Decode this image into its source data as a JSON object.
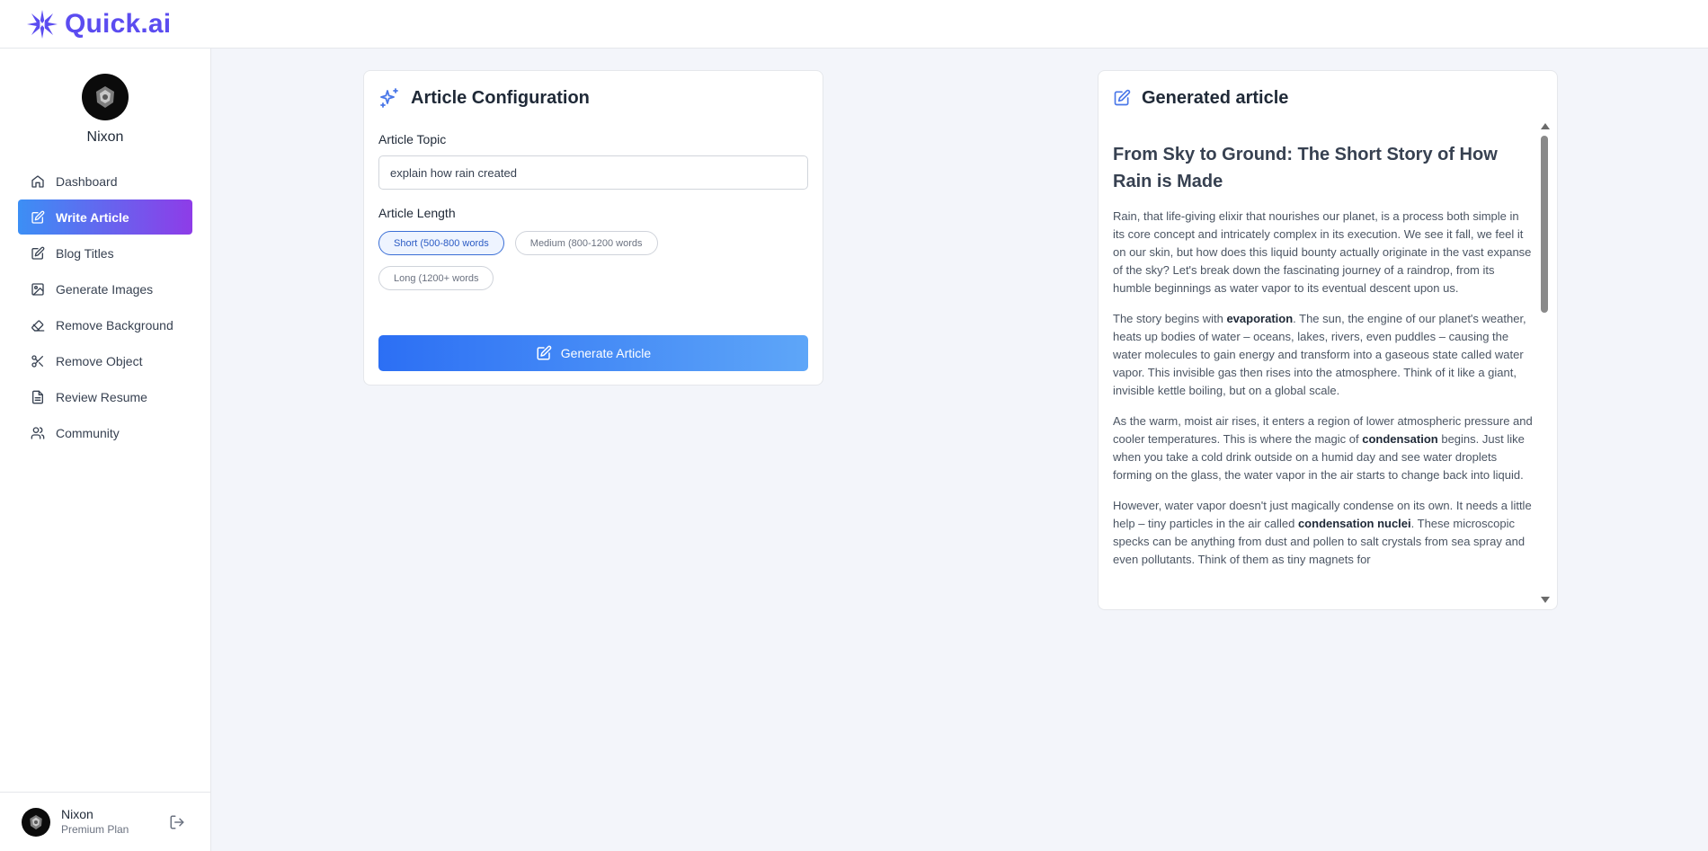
{
  "app": {
    "name": "Quick.ai",
    "brand_color": "#5b4cf0"
  },
  "user": {
    "name": "Nixon",
    "plan": "Premium Plan"
  },
  "sidebar": {
    "items": [
      {
        "label": "Dashboard",
        "icon": "home-icon",
        "active": false
      },
      {
        "label": "Write Article",
        "icon": "edit-icon",
        "active": true
      },
      {
        "label": "Blog Titles",
        "icon": "edit-icon",
        "active": false
      },
      {
        "label": "Generate Images",
        "icon": "image-icon",
        "active": false
      },
      {
        "label": "Remove Background",
        "icon": "eraser-icon",
        "active": false
      },
      {
        "label": "Remove Object",
        "icon": "scissors-icon",
        "active": false
      },
      {
        "label": "Review Resume",
        "icon": "file-text-icon",
        "active": false
      },
      {
        "label": "Community",
        "icon": "users-icon",
        "active": false
      }
    ]
  },
  "config": {
    "title": "Article Configuration",
    "topic_label": "Article Topic",
    "topic_value": "explain how rain created",
    "length_label": "Article Length",
    "length_options": [
      {
        "label": "Short (500-800 words",
        "selected": true
      },
      {
        "label": "Medium (800-1200 words",
        "selected": false
      },
      {
        "label": "Long (1200+ words",
        "selected": false
      }
    ],
    "generate_label": "Generate Article"
  },
  "article": {
    "panel_title": "Generated article",
    "heading": "From Sky to Ground: The Short Story of How Rain is Made",
    "paragraphs": [
      {
        "pre": "Rain, that life-giving elixir that nourishes our planet, is a process both simple in its core concept and intricately complex in its execution. We see it fall, we feel it on our skin, but how does this liquid bounty actually originate in the vast expanse of the sky? Let's break down the fascinating journey of a raindrop, from its humble beginnings as water vapor to its eventual descent upon us.",
        "bold": "",
        "post": ""
      },
      {
        "pre": "The story begins with ",
        "bold": "evaporation",
        "post": ". The sun, the engine of our planet's weather, heats up bodies of water – oceans, lakes, rivers, even puddles – causing the water molecules to gain energy and transform into a gaseous state called water vapor. This invisible gas then rises into the atmosphere. Think of it like a giant, invisible kettle boiling, but on a global scale."
      },
      {
        "pre": "As the warm, moist air rises, it enters a region of lower atmospheric pressure and cooler temperatures. This is where the magic of ",
        "bold": "condensation",
        "post": " begins. Just like when you take a cold drink outside on a humid day and see water droplets forming on the glass, the water vapor in the air starts to change back into liquid."
      },
      {
        "pre": "However, water vapor doesn't just magically condense on its own. It needs a little help – tiny particles in the air called ",
        "bold": "condensation nuclei",
        "post": ". These microscopic specks can be anything from dust and pollen to salt crystals from sea spray and even pollutants. Think of them as tiny magnets for"
      }
    ]
  }
}
